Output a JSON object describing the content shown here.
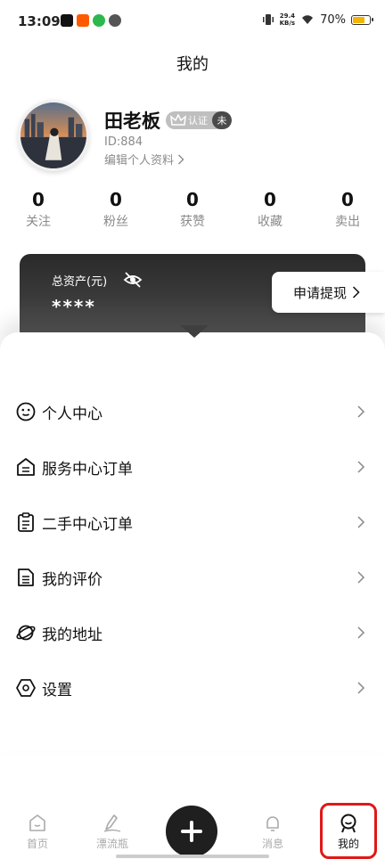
{
  "status_bar": {
    "time": "13:09",
    "speed_value": "29.4",
    "speed_unit": "KB/s",
    "battery": "70%",
    "app_icons": [
      "tiktok-icon",
      "taobao-icon",
      "green-app-icon",
      "wechat-icon"
    ],
    "battery_color": "#f5b400"
  },
  "page_title": "我的",
  "profile": {
    "name": "田老板",
    "verify_label": "认证",
    "verify_state": "未",
    "id_text": "ID:884",
    "edit_text": "编辑个人资料"
  },
  "stats": [
    {
      "value": "0",
      "label": "关注"
    },
    {
      "value": "0",
      "label": "粉丝"
    },
    {
      "value": "0",
      "label": "获赞"
    },
    {
      "value": "0",
      "label": "收藏"
    },
    {
      "value": "0",
      "label": "卖出"
    }
  ],
  "assets": {
    "label": "总资产(元)",
    "value": "****",
    "withdraw_label": "申请提现"
  },
  "menu": [
    {
      "label": "个人中心",
      "icon": "smiley-icon"
    },
    {
      "label": "服务中心订单",
      "icon": "house-icon"
    },
    {
      "label": "二手中心订单",
      "icon": "clipboard-icon"
    },
    {
      "label": "我的评价",
      "icon": "document-icon"
    },
    {
      "label": "我的地址",
      "icon": "planet-icon"
    },
    {
      "label": "设置",
      "icon": "hexagon-icon"
    }
  ],
  "tabbar": {
    "home": "首页",
    "drift": "漂流瓶",
    "messages": "消息",
    "mine": "我的"
  },
  "colors": {
    "highlight": "#e01818",
    "card_dark": "#2a2a2a"
  }
}
